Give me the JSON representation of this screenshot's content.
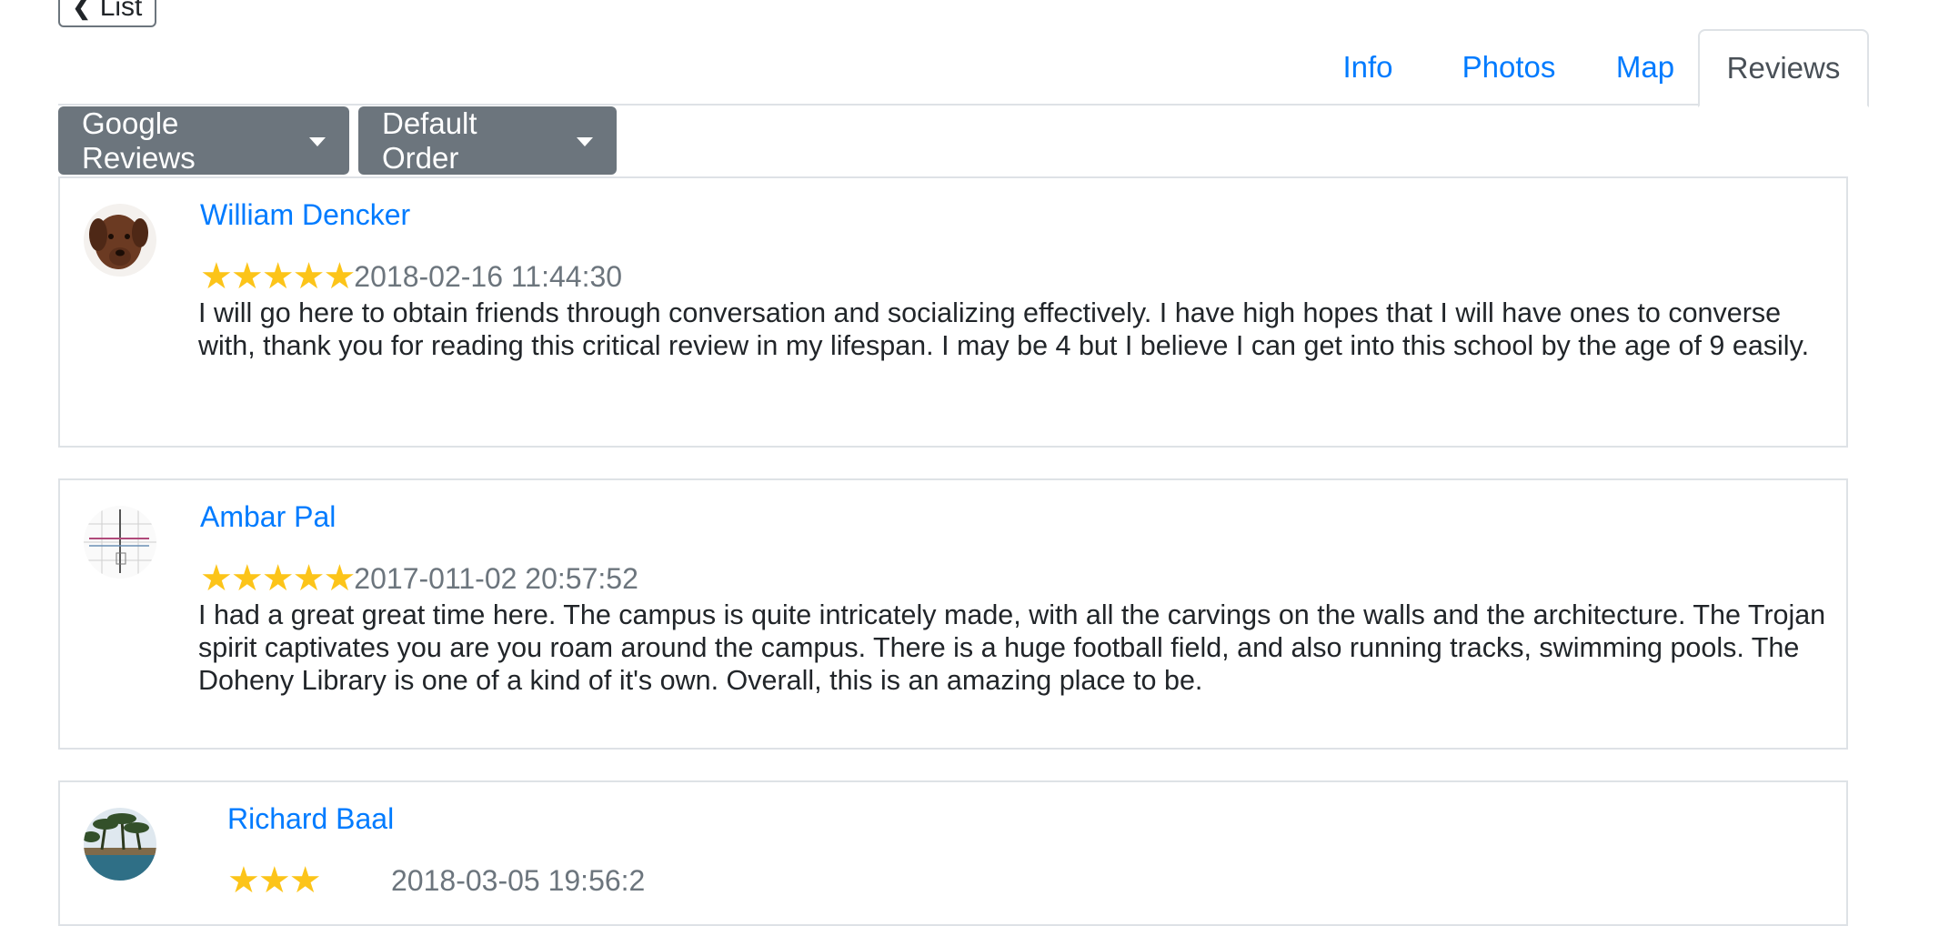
{
  "nav": {
    "back_label": "List"
  },
  "tabs": [
    "Info",
    "Photos",
    "Map",
    "Reviews"
  ],
  "active_tab": "Reviews",
  "filters": {
    "source_label": "Google Reviews",
    "order_label": "Default Order"
  },
  "reviews": [
    {
      "author": "William Dencker",
      "rating": 5,
      "stars": "★★★★★",
      "date": "2018-02-16 11:44:30",
      "text": "I will go here to obtain friends through conversation and socializing effectively. I have high hopes that I will have ones to converse with, thank you for reading this critical review in my lifespan. I may be 4 but I believe I can get into this school by the age of 9 easily."
    },
    {
      "author": "Ambar Pal",
      "rating": 5,
      "stars": "★★★★★",
      "date": "2017-011-02 20:57:52",
      "text": "I had a great great time here. The campus is quite intricately made, with all the carvings on the walls and the architecture. The Trojan spirit captivates you are you roam around the campus. There is a huge football field, and also running tracks, swimming pools. The Doheny Library is one of a kind of it's own. Overall, this is an amazing place to be."
    },
    {
      "author": "Richard Baal",
      "rating": 3,
      "stars": "★★★",
      "date": "2018-03-05 19:56:2",
      "text": ""
    }
  ],
  "colors": {
    "link": "#007bff",
    "star": "#fcc419",
    "button": "#6c757d",
    "muted": "#6c757d"
  }
}
